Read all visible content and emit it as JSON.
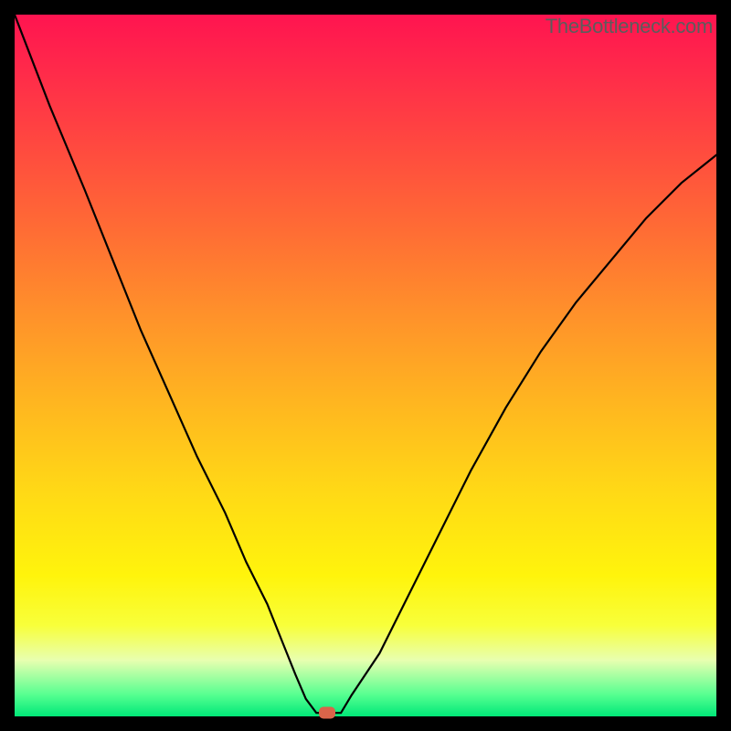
{
  "watermark": "TheBottleneck.com",
  "chart_data": {
    "type": "line",
    "title": "",
    "xlabel": "",
    "ylabel": "",
    "xlim": [
      0,
      100
    ],
    "ylim": [
      0,
      100
    ],
    "gradient_stops": [
      {
        "pct": 0,
        "color": "#ff1450"
      },
      {
        "pct": 8,
        "color": "#ff2a4a"
      },
      {
        "pct": 18,
        "color": "#ff4740"
      },
      {
        "pct": 30,
        "color": "#ff6a35"
      },
      {
        "pct": 42,
        "color": "#ff8f2b"
      },
      {
        "pct": 55,
        "color": "#ffb520"
      },
      {
        "pct": 68,
        "color": "#ffd916"
      },
      {
        "pct": 80,
        "color": "#fff40c"
      },
      {
        "pct": 87,
        "color": "#f8ff3a"
      },
      {
        "pct": 92,
        "color": "#e8ffb0"
      },
      {
        "pct": 97,
        "color": "#54ff90"
      },
      {
        "pct": 100,
        "color": "#00e878"
      }
    ],
    "series": [
      {
        "name": "bottleneck-curve",
        "x": [
          0,
          5,
          10,
          14,
          18,
          22,
          26,
          30,
          33,
          36,
          38,
          40,
          41.5,
          43,
          45,
          46.5,
          48,
          52,
          56,
          60,
          65,
          70,
          75,
          80,
          85,
          90,
          95,
          100
        ],
        "y": [
          100,
          87,
          75,
          65,
          55,
          46,
          37,
          29,
          22,
          16,
          11,
          6,
          2.5,
          0.5,
          0.5,
          0.5,
          3,
          9,
          17,
          25,
          35,
          44,
          52,
          59,
          65,
          71,
          76,
          80
        ]
      }
    ],
    "marker": {
      "x": 44.5,
      "y": 0.5,
      "color": "#d9644a"
    },
    "flat_segment": {
      "x_start": 43,
      "x_end": 46.5,
      "y": 0.5
    }
  }
}
